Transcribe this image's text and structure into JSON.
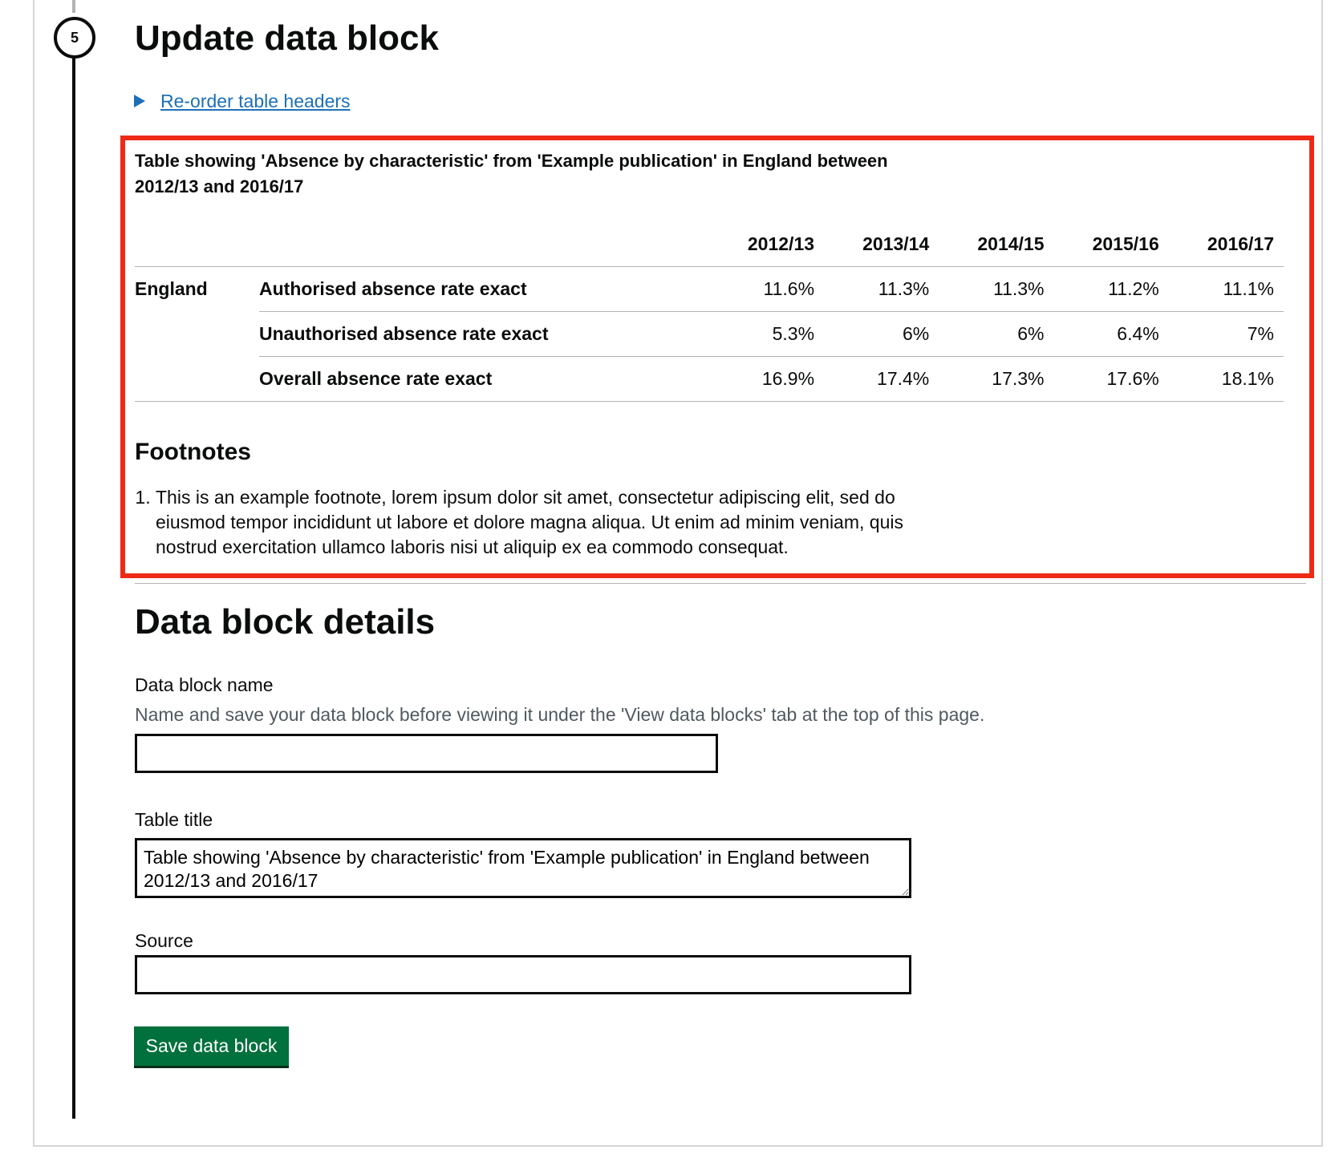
{
  "step": {
    "number": "5",
    "title": "Update data block"
  },
  "details_toggle": {
    "label": "Re-order table headers"
  },
  "table": {
    "caption": "Table showing 'Absence by characteristic' from 'Example publication' in England between 2012/13 and 2016/17",
    "columns": [
      "2012/13",
      "2013/14",
      "2014/15",
      "2015/16",
      "2016/17"
    ],
    "group": "England",
    "rows": [
      {
        "label": "Authorised absence rate exact",
        "values": [
          "11.6%",
          "11.3%",
          "11.3%",
          "11.2%",
          "11.1%"
        ]
      },
      {
        "label": "Unauthorised absence rate exact",
        "values": [
          "5.3%",
          "6%",
          "6%",
          "6.4%",
          "7%"
        ]
      },
      {
        "label": "Overall absence rate exact",
        "values": [
          "16.9%",
          "17.4%",
          "17.3%",
          "17.6%",
          "18.1%"
        ]
      }
    ]
  },
  "footnotes": {
    "heading": "Footnotes",
    "items": [
      "This is an example footnote, lorem ipsum dolor sit amet, consectetur adipiscing elit, sed do eiusmod tempor incididunt ut labore et dolore magna aliqua. Ut enim ad minim veniam, quis nostrud exercitation ullamco laboris nisi ut aliquip ex ea commodo consequat."
    ]
  },
  "form": {
    "heading": "Data block details",
    "name_label": "Data block name",
    "name_hint": "Name and save your data block before viewing it under the 'View data blocks' tab at the top of this page.",
    "name_value": "",
    "title_label": "Table title",
    "title_value": "Table showing 'Absence by characteristic' from 'Example publication' in England between 2012/13 and 2016/17",
    "source_label": "Source",
    "source_value": "",
    "save_label": "Save data block"
  },
  "colors": {
    "accent_link": "#1d70b8",
    "highlight": "#ee2a16",
    "button": "#00703c"
  }
}
